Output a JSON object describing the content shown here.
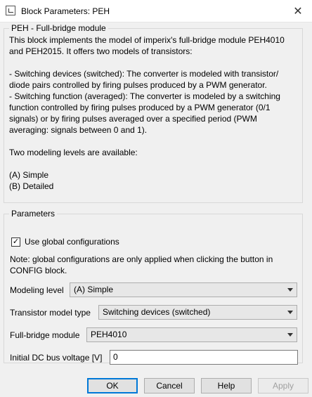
{
  "window": {
    "title": "Block Parameters: PEH",
    "icon": "simulink-block-icon",
    "close_glyph": "✕"
  },
  "description_section": {
    "legend": "PEH - Full-bridge module",
    "text": "This block implements the model of imperix's full-bridge module PEH4010\nand PEH2015. It offers two models of transistors:\n\n- Switching devices (switched): The converter is modeled with transistor/\ndiode pairs controlled by firing pulses produced by a PWM generator.\n- Switching function (averaged): The converter is modeled by a switching\nfunction controlled by firing pulses produced by a PWM generator (0/1\nsignals) or by firing pulses averaged over a specified period (PWM\naveraging: signals between 0 and 1).\n\nTwo modeling levels are available:\n\n(A) Simple\n(B) Detailed"
  },
  "parameters": {
    "legend": "Parameters",
    "use_global": {
      "label": "Use global configurations",
      "checked": true,
      "mark": "✓"
    },
    "note": "Note: global configurations are only applied when clicking the button in CONFIG block.",
    "modeling_level": {
      "label": "Modeling level",
      "value": "(A) Simple"
    },
    "transistor_model": {
      "label": "Transistor model type",
      "value": "Switching devices (switched)"
    },
    "full_bridge_module": {
      "label": "Full-bridge module",
      "value": "PEH4010"
    },
    "initial_dc_bus": {
      "label": "Initial DC bus voltage [V]",
      "value": "0"
    }
  },
  "buttons": {
    "ok": "OK",
    "cancel": "Cancel",
    "help": "Help",
    "apply": "Apply"
  },
  "colors": {
    "focus_border": "#0078d7",
    "dialog_bg": "#f0f0f0"
  }
}
